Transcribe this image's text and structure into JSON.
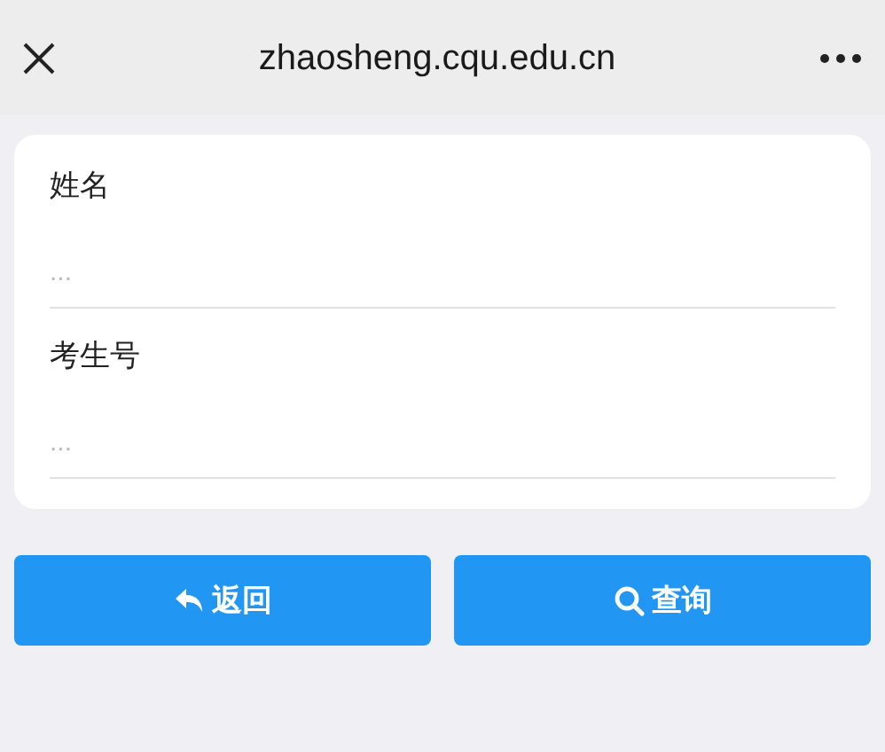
{
  "header": {
    "title": "zhaosheng.cqu.edu.cn"
  },
  "fields": [
    {
      "label": "姓名",
      "placeholder": "..."
    },
    {
      "label": "考生号",
      "placeholder": "..."
    }
  ],
  "buttons": [
    {
      "label": "返回",
      "kind": "back"
    },
    {
      "label": "查询",
      "kind": "search"
    }
  ]
}
